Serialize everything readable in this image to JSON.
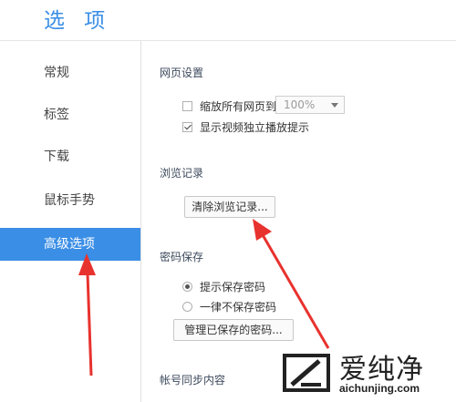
{
  "window": {
    "title": "选 项"
  },
  "sidebar": {
    "items": [
      {
        "label": "常规"
      },
      {
        "label": "标签"
      },
      {
        "label": "下载"
      },
      {
        "label": "鼠标手势"
      },
      {
        "label": "高级选项",
        "active": true
      }
    ]
  },
  "sections": {
    "web": {
      "title": "网页设置",
      "zoom_all_label": "缩放所有网页到",
      "zoom_all_checked": false,
      "zoom_value": "100%",
      "video_label": "显示视频独立播放提示",
      "video_checked": true
    },
    "history": {
      "title": "浏览记录",
      "clear_button": "清除浏览记录..."
    },
    "password": {
      "title": "密码保存",
      "option_prompt": "提示保存密码",
      "option_never": "一律不保存密码",
      "selected": "提示保存密码",
      "manage_button": "管理已保存的密码..."
    },
    "sync": {
      "title": "帐号同步内容"
    }
  },
  "watermark": {
    "brand": "爱纯净",
    "url": "aichunjing.com"
  },
  "colors": {
    "accent": "#3a8ee6",
    "arrow": "#e8322e"
  }
}
